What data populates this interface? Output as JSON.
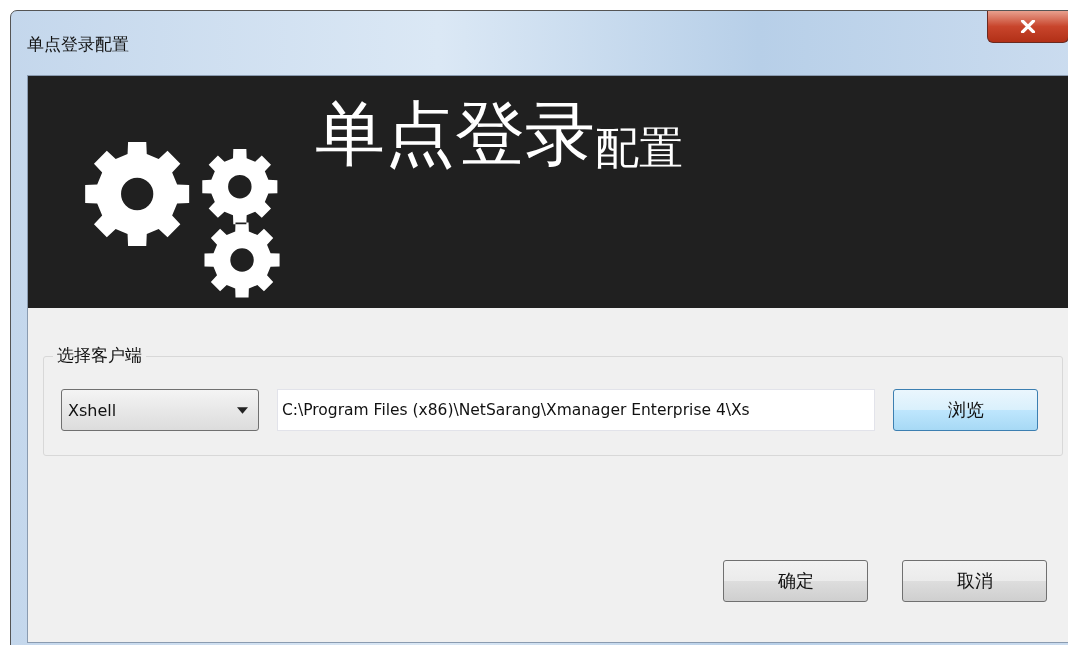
{
  "window": {
    "title": "单点登录配置"
  },
  "banner": {
    "title": "单点登录",
    "subtitle": "配置"
  },
  "client_group": {
    "label": "选择客户端",
    "client": {
      "value": "Xshell"
    },
    "path": {
      "value": "C:\\Program Files (x86)\\NetSarang\\Xmanager Enterprise 4\\Xs"
    },
    "browse_button": "浏览"
  },
  "buttons": [
    "确定",
    "取消"
  ]
}
